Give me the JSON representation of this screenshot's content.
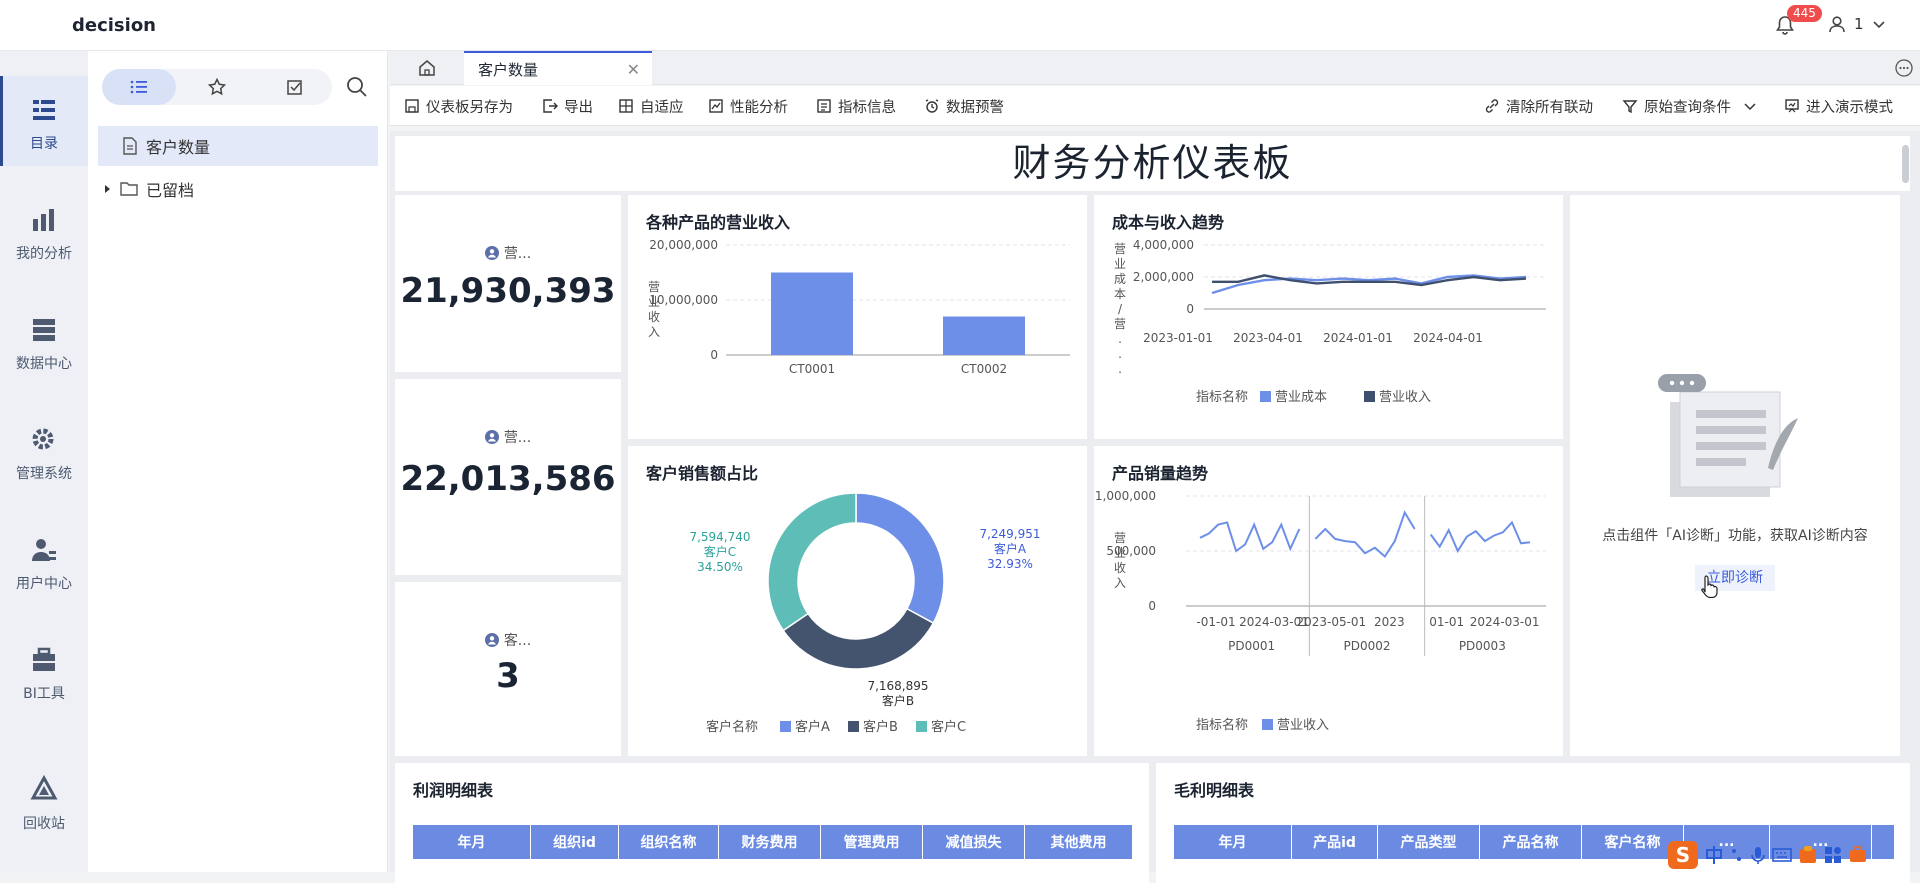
{
  "app": {
    "brand": "decision",
    "notif_count": "445",
    "user_name": "1"
  },
  "nav": {
    "items": [
      {
        "label": "目录"
      },
      {
        "label": "我的分析"
      },
      {
        "label": "数据中心"
      },
      {
        "label": "管理系统"
      },
      {
        "label": "用户中心"
      },
      {
        "label": "BI工具"
      },
      {
        "label": "回收站"
      }
    ]
  },
  "tree": {
    "items": [
      {
        "label": "客户数量"
      },
      {
        "label": "已留档"
      }
    ]
  },
  "tabs": {
    "active_tab": "客户数量"
  },
  "toolbar": {
    "save_as": "仪表板另存为",
    "export": "导出",
    "adapt": "自适应",
    "perf": "性能分析",
    "indicator": "指标信息",
    "alert": "数据预警",
    "clear_links": "清除所有联动",
    "query_cond": "原始查询条件",
    "present": "进入演示模式"
  },
  "dashboard": {
    "title": "财务分析仪表板",
    "kpis": [
      {
        "label": "营...",
        "value": "21,930,393"
      },
      {
        "label": "营...",
        "value": "22,013,586"
      },
      {
        "label": "客...",
        "value": "3"
      }
    ],
    "ai": {
      "hint": "点击组件「AI诊断」功能，获取AI诊断内容",
      "button": "立即诊断"
    },
    "tables": [
      {
        "title": "利润明细表",
        "columns": [
          "年月",
          "组织id",
          "组织名称",
          "财务费用",
          "管理费用",
          "减值损失",
          "其他费用"
        ]
      },
      {
        "title": "毛利明细表",
        "columns": [
          "年月",
          "产品id",
          "产品类型",
          "产品名称",
          "客户名称",
          "...",
          "..."
        ]
      }
    ]
  },
  "chart_data": [
    {
      "type": "bar",
      "title": "各种产品的营业收入",
      "ylabel": "营业收入",
      "categories": [
        "CT0001",
        "CT0002"
      ],
      "values": [
        15000000,
        7000000
      ],
      "ylim": [
        0,
        20000000
      ],
      "yticks": [
        "20,000,000",
        "10,000,000",
        "0"
      ],
      "color": "#6d8fe8"
    },
    {
      "type": "line",
      "title": "成本与收入趋势",
      "ylabel": "营业成本/营...",
      "xticks": [
        "2023-01-01",
        "2023-04-01",
        "2024-01-01",
        "2024-04-01"
      ],
      "yticks": [
        "4,000,000",
        "2,000,000",
        "0"
      ],
      "ylim": [
        0,
        4000000
      ],
      "legend_title": "指标名称",
      "series": [
        {
          "name": "营业成本",
          "color": "#6d8fe8",
          "values": [
            1000000,
            1500000,
            1800000,
            1900000,
            1800000,
            1900000,
            1800000,
            1900000,
            1600000,
            2000000,
            2100000,
            1900000,
            2000000
          ]
        },
        {
          "name": "营业收入",
          "color": "#3f4f6e",
          "values": [
            1700000,
            1700000,
            2100000,
            1800000,
            1600000,
            1700000,
            1700000,
            1700000,
            1500000,
            1800000,
            2000000,
            1800000,
            1900000
          ]
        }
      ]
    },
    {
      "type": "pie",
      "title": "客户销售额占比",
      "legend_title": "客户名称",
      "slices": [
        {
          "name": "客户A",
          "value": 7249951,
          "value_label": "7,249,951",
          "pct": "32.93%",
          "color": "#6d8fe8"
        },
        {
          "name": "客户B",
          "value": 7168895,
          "value_label": "7,168,895",
          "pct": "",
          "color": "#44546f"
        },
        {
          "name": "客户C",
          "value": 7594740,
          "value_label": "7,594,740",
          "pct": "34.50%",
          "color": "#5fbdb7"
        }
      ]
    },
    {
      "type": "line",
      "title": "产品销量趋势",
      "ylabel": "营业收入",
      "yticks": [
        "1,000,000",
        "500,000",
        "0"
      ],
      "ylim": [
        0,
        1000000
      ],
      "legend_title": "指标名称",
      "series_name": "营业收入",
      "color": "#6d8fe8",
      "panels": [
        {
          "name": "PD0001",
          "xticks": [
            "-01-01",
            "2024-03-01"
          ],
          "values": [
            620000,
            660000,
            740000,
            760000,
            500000,
            560000,
            740000,
            520000,
            580000,
            740000,
            520000,
            700000
          ]
        },
        {
          "name": "PD0002",
          "xticks": [
            "2023-05-01",
            "2023"
          ],
          "values": [
            610000,
            700000,
            610000,
            590000,
            580000,
            480000,
            530000,
            450000,
            590000,
            850000,
            700000
          ]
        },
        {
          "name": "PD0003",
          "xticks": [
            "01-01",
            "2024-03-01"
          ],
          "values": [
            650000,
            540000,
            690000,
            500000,
            630000,
            680000,
            590000,
            640000,
            670000,
            760000,
            570000,
            580000
          ]
        }
      ]
    }
  ]
}
